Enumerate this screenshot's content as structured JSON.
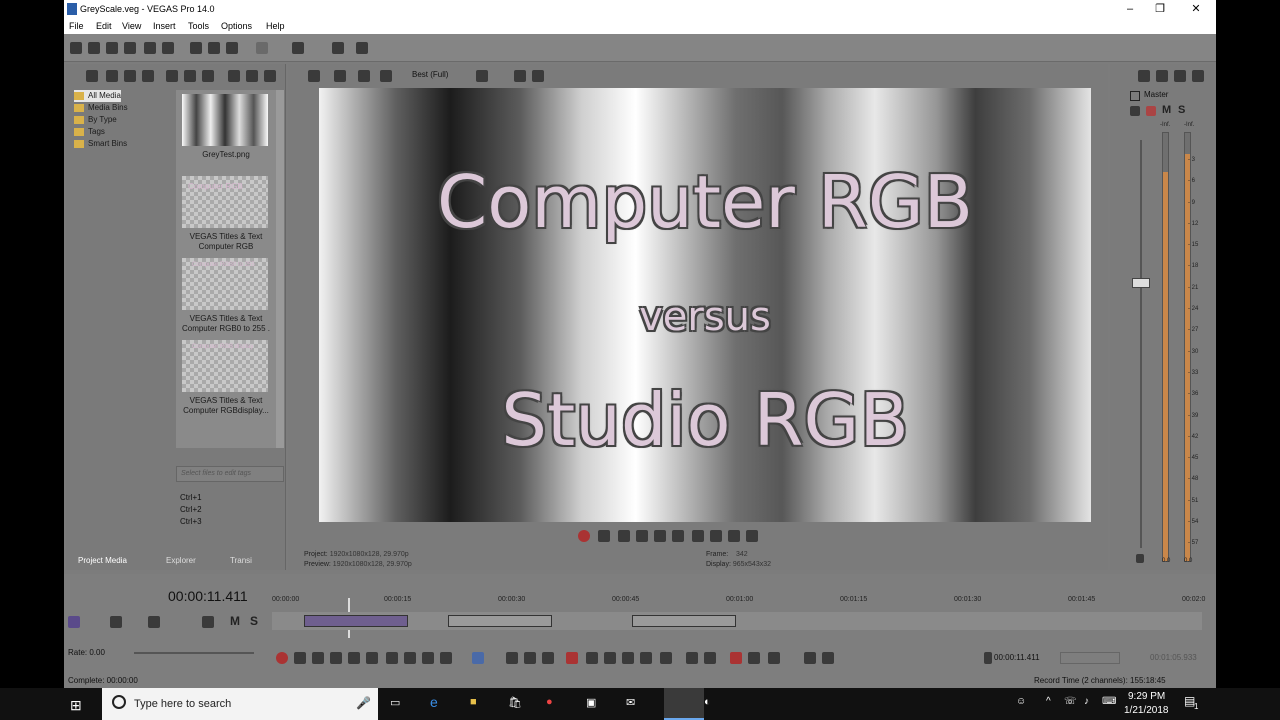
{
  "window": {
    "title": "GreyScale.veg - VEGAS Pro 14.0",
    "min": "–",
    "max": "❐",
    "close": "✕"
  },
  "menu": [
    "File",
    "Edit",
    "View",
    "Insert",
    "Tools",
    "Options",
    "Help"
  ],
  "preview_toolbar": {
    "quality": "Best (Full)"
  },
  "media_tree": [
    "All Media",
    "Media Bins",
    "By Type",
    "Tags",
    "Smart Bins"
  ],
  "media_items": [
    {
      "name": "GreyTest.png"
    },
    {
      "name": "VEGAS Titles & Text\nComputer RGB"
    },
    {
      "name": "VEGAS Titles & Text\nComputer RGB0 to 255 ."
    },
    {
      "name": "VEGAS Titles & Text\nComputer RGBdisplay..."
    }
  ],
  "thumb_labels": [
    "Computer RGB",
    "Computer RGB0 to 255",
    "Computer RGB display"
  ],
  "tags_placeholder": "Select files to edit tags",
  "shortcuts": [
    "Ctrl+1",
    "Ctrl+2",
    "Ctrl+3"
  ],
  "tabs": [
    "Project Media",
    "Explorer",
    "Transi"
  ],
  "video": {
    "line1": "Computer RGB",
    "line2": "versus",
    "line3": "Studio RGB"
  },
  "preview_info": {
    "project_label": "Project:",
    "project_value": "1920x1080x128, 29.970p",
    "preview_label": "Preview:",
    "preview_value": "1920x1080x128, 29.970p",
    "frame_label": "Frame:",
    "frame_value": "342",
    "display_label": "Display:",
    "display_value": "965x543x32"
  },
  "master": {
    "label": "Master",
    "m": "M",
    "s": "S",
    "left_val": "0.0",
    "right_val": "0.0",
    "inf": "-Inf."
  },
  "meter_scale": [
    "3",
    "6",
    "9",
    "12",
    "15",
    "18",
    "21",
    "24",
    "27",
    "30",
    "33",
    "36",
    "39",
    "42",
    "45",
    "48",
    "51",
    "54",
    "57"
  ],
  "meter_levels": [
    0.91,
    0.95
  ],
  "timecode": "00:00:11.411",
  "track_buttons": {
    "m": "M",
    "s": "S"
  },
  "ruler_marks": [
    "00:00:00",
    "00:00:15",
    "00:00:30",
    "00:00:45",
    "00:01:00",
    "00:01:15",
    "00:01:30",
    "00:01:45",
    "00:02:0"
  ],
  "rate": "Rate: 0.00",
  "transport_time": "00:00:11.411",
  "transport_time2": "00:01:05.933",
  "status_left": "Complete: 00:00:00",
  "status_right": "Record Time (2 channels): 155:18:45",
  "taskbar": {
    "search_placeholder": "Type here to search",
    "time": "9:29 PM",
    "date": "1/21/2018",
    "notif": "1"
  }
}
